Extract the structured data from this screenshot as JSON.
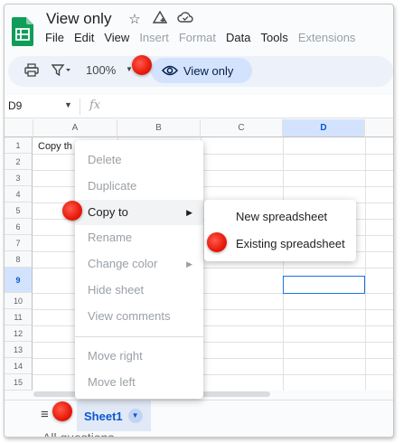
{
  "header": {
    "title": "View only",
    "menu": [
      {
        "label": "File",
        "enabled": true
      },
      {
        "label": "Edit",
        "enabled": true
      },
      {
        "label": "View",
        "enabled": true
      },
      {
        "label": "Insert",
        "enabled": false
      },
      {
        "label": "Format",
        "enabled": false
      },
      {
        "label": "Data",
        "enabled": true
      },
      {
        "label": "Tools",
        "enabled": true
      },
      {
        "label": "Extensions",
        "enabled": false
      }
    ],
    "icons": [
      "star-icon",
      "move-to-drive-icon",
      "cloud-status-icon"
    ]
  },
  "toolbar": {
    "zoom": "100%",
    "view_only_label": "View only",
    "icons": [
      "print-icon",
      "filter-icon",
      "eye-icon"
    ]
  },
  "formula_bar": {
    "cell_ref": "D9",
    "fx": "fx"
  },
  "grid": {
    "columns": [
      "A",
      "B",
      "C",
      "D"
    ],
    "selected_column": "D",
    "rows": [
      "1",
      "2",
      "3",
      "4",
      "5",
      "6",
      "7",
      "8",
      "9",
      "10",
      "11",
      "12",
      "13",
      "14",
      "15"
    ],
    "selected_row": "9",
    "cell_a1": "Copy th"
  },
  "context_menu": {
    "items": [
      {
        "label": "Delete",
        "enabled": false
      },
      {
        "label": "Duplicate",
        "enabled": false
      },
      {
        "label": "Copy to",
        "enabled": true,
        "submenu": true,
        "active": true
      },
      {
        "label": "Rename",
        "enabled": false
      },
      {
        "label": "Change color",
        "enabled": false,
        "submenu": true
      },
      {
        "label": "Hide sheet",
        "enabled": false
      },
      {
        "label": "View comments",
        "enabled": false
      },
      {
        "label": "Move right",
        "enabled": false
      },
      {
        "label": "Move left",
        "enabled": false
      }
    ]
  },
  "submenu": {
    "items": [
      "New spreadsheet",
      "Existing spreadsheet"
    ]
  },
  "sheets": {
    "active_tab": "Sheet1",
    "clipped_text": "All questions"
  },
  "colors": {
    "accent": "#0b57d0",
    "sheets_green": "#0f9d58",
    "highlight_dot": "#e8190a",
    "view_only_pill": "#d3e3fd"
  }
}
